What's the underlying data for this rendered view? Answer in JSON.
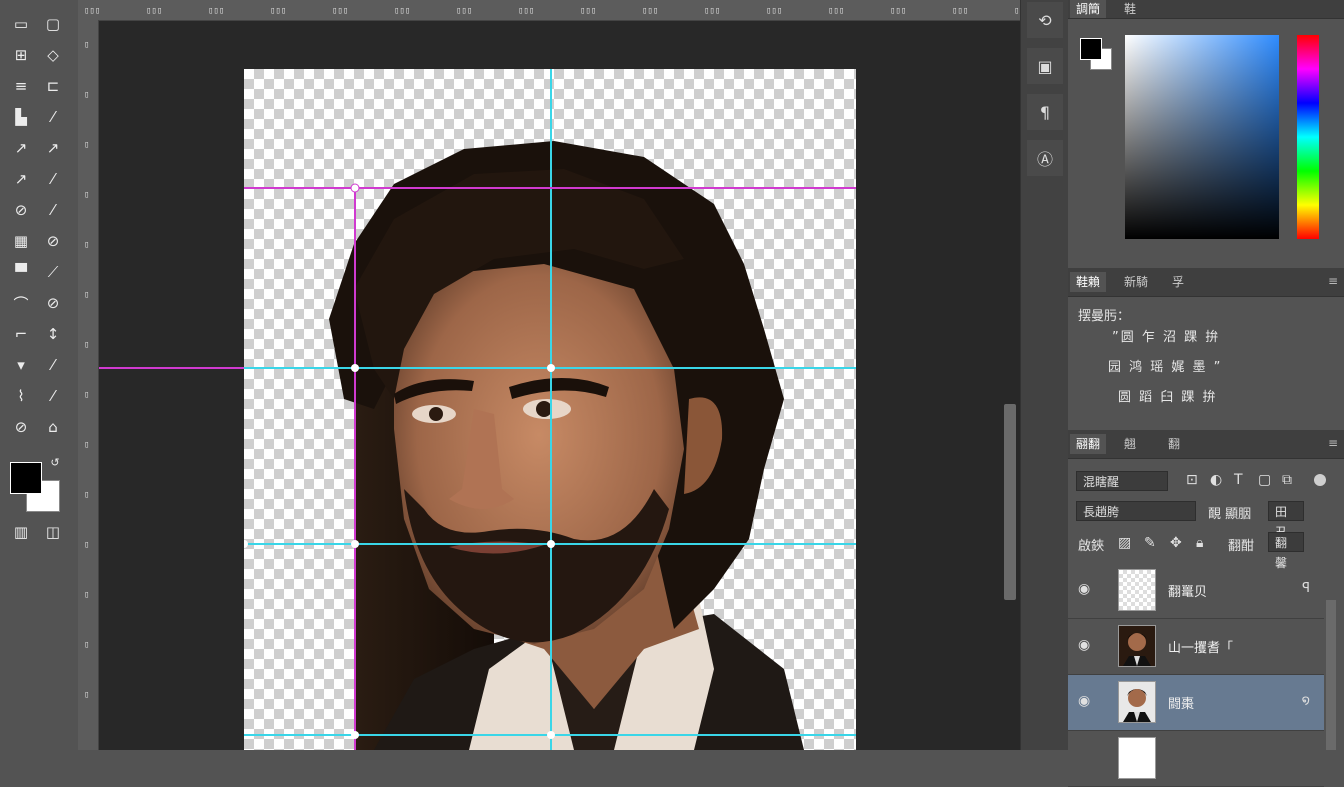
{
  "colors": {
    "foreground": "#000000",
    "background": "#ffffff",
    "guide_cyan": "#3ad6e8",
    "guide_magenta": "#d03ad0",
    "layer_selected": "#677a91"
  },
  "toolbar": {
    "tools": [
      {
        "icon": "move-icon",
        "glyph": "▭"
      },
      {
        "icon": "artboard-icon",
        "glyph": "▢"
      },
      {
        "icon": "marquee-icon",
        "glyph": "⊞"
      },
      {
        "icon": "lasso-icon",
        "glyph": "◇"
      },
      {
        "icon": "quick-select-icon",
        "glyph": "≡"
      },
      {
        "icon": "crop-icon",
        "glyph": "⊏"
      },
      {
        "icon": "eyedropper-icon",
        "glyph": "▙"
      },
      {
        "icon": "brush-icon",
        "glyph": "⁄"
      },
      {
        "icon": "healing-icon",
        "glyph": "↗"
      },
      {
        "icon": "stamp-icon",
        "glyph": "↗"
      },
      {
        "icon": "history-brush-icon",
        "glyph": "↗"
      },
      {
        "icon": "eraser-icon",
        "glyph": "⁄"
      },
      {
        "icon": "gradient-icon",
        "glyph": "⊘"
      },
      {
        "icon": "blur-icon",
        "glyph": "⁄"
      },
      {
        "icon": "dodge-icon",
        "glyph": "▦"
      },
      {
        "icon": "pen-icon",
        "glyph": "⊘"
      },
      {
        "icon": "type-icon",
        "glyph": "▀"
      },
      {
        "icon": "path-select-icon",
        "glyph": "⟋"
      },
      {
        "icon": "shape-icon",
        "glyph": "⌒"
      },
      {
        "icon": "hand-icon",
        "glyph": "⊘"
      },
      {
        "icon": "zoom-icon",
        "glyph": "⌐"
      },
      {
        "icon": "rotate-view-icon",
        "glyph": "↕"
      },
      {
        "icon": "note-icon",
        "glyph": "▾"
      },
      {
        "icon": "count-icon",
        "glyph": "⁄"
      },
      {
        "icon": "ruler-icon",
        "glyph": "⌇"
      },
      {
        "icon": "frame-icon",
        "glyph": "⁄"
      },
      {
        "icon": "sponge-icon",
        "glyph": "⊘"
      },
      {
        "icon": "smudge-icon",
        "glyph": "⌂"
      }
    ],
    "mode_icons": [
      {
        "icon": "quick-mask-icon",
        "glyph": "▥"
      },
      {
        "icon": "screen-mode-icon",
        "glyph": "◫"
      }
    ]
  },
  "rpanel": {
    "color_tabs": [
      "調簡",
      "鞋"
    ],
    "adjust_tabs": [
      "鞋賴",
      "新騎",
      "孚"
    ],
    "adjust_title": "摆曼肟：",
    "adjust_rows": [
      "”圆 乍 沼 踝 拚",
      "园 鸿 瑶 娓 墨 ”",
      "圆 蹈 臼 踝 拚"
    ],
    "layers_tabs": [
      "翮翻",
      "翹",
      "翻"
    ],
    "filter_label": "混瞎醒",
    "blend_mode": "長趙胯",
    "opacity_label": "靦 顯胭",
    "opacity_value": "田丑",
    "lock_label": "啟鋏",
    "fill_label": "翻酣",
    "fill_value": "翻馨",
    "layers": [
      {
        "name": "翻鼍贝",
        "badge": "ꟼ",
        "thumb": "transparent"
      },
      {
        "name": "山一攫耆「",
        "badge": "",
        "thumb": "portrait"
      },
      {
        "name": "闘棗",
        "badge": "໑",
        "thumb": "portrait",
        "selected": true
      }
    ]
  }
}
